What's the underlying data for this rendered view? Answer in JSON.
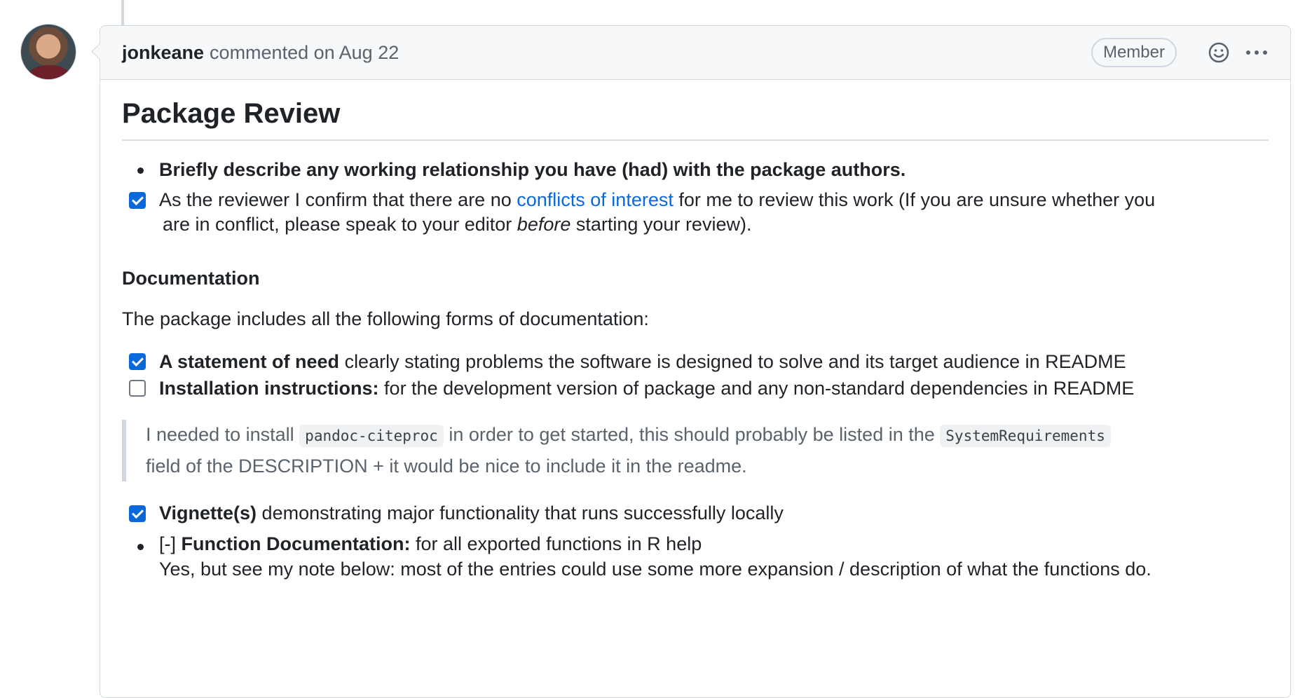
{
  "comment": {
    "author": "jonkeane",
    "meta": "commented on Aug 22",
    "badge": "Member"
  },
  "body": {
    "heading": "Package Review",
    "relationship": "Briefly describe any working relationship you have (had) with the package authors.",
    "coi": {
      "checked": true,
      "before": "As the reviewer I confirm that there are no",
      "link": "conflicts of interest",
      "after": "for me to review this work (If you are unsure whether you",
      "line2_a": "are in conflict, please speak to your editor",
      "line2_em": "before",
      "line2_b": "starting your review)."
    },
    "documentation_heading": "Documentation",
    "documentation_intro": "The package includes all the following forms of documentation:",
    "tasks": [
      {
        "checked": true,
        "bold": "A statement of need",
        "text": "clearly stating problems the software is designed to solve and its target audience in README"
      },
      {
        "checked": false,
        "bold": "Installation instructions:",
        "text": "for the development version of package and any non-standard dependencies in README"
      }
    ],
    "quote": {
      "part1": "I needed to install",
      "code1": "pandoc-citeproc",
      "part2": "in order to get started, this should probably be listed in the",
      "code2": "SystemRequirements",
      "line2": "field of the DESCRIPTION + it would be nice to include it in the readme."
    },
    "vignette": {
      "checked": true,
      "bold": "Vignette(s)",
      "text": "demonstrating major functionality that runs successfully locally"
    },
    "function_docs": {
      "prefix": "[-]",
      "bold": "Function Documentation:",
      "text": "for all exported functions in R help",
      "line2": "Yes, but see my note below: most of the entries could use some more expansion / description of what the functions do."
    }
  }
}
